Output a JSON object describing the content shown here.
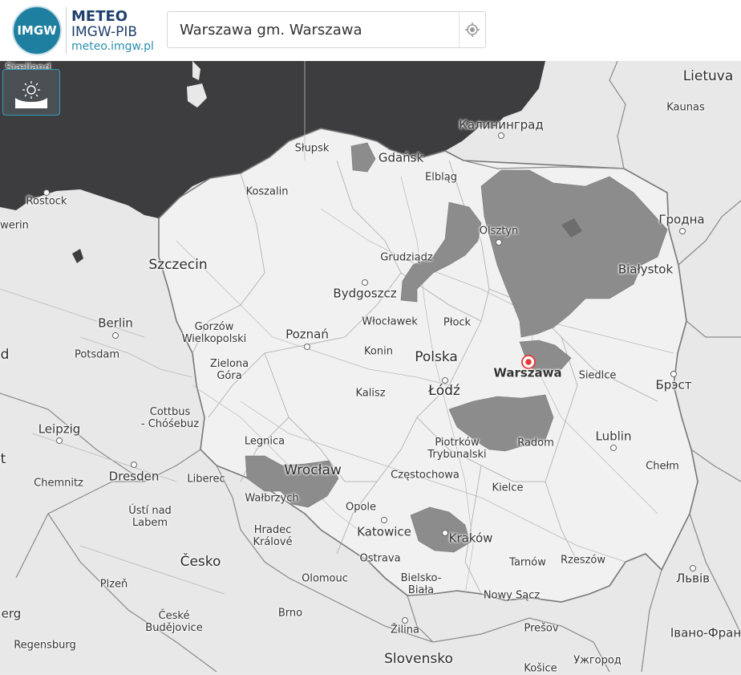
{
  "header": {
    "logo_text": "IMGW",
    "brand_line1": "METEO",
    "brand_line2": "IMGW-PIB",
    "brand_line3": "meteo.imgw.pl"
  },
  "search": {
    "value": "Warszawa gm. Warszawa",
    "placeholder": "",
    "locate_icon": "crosshair-icon"
  },
  "layer_toggle": {
    "icon": "sun-sea-icon"
  },
  "map": {
    "colors": {
      "sea": "#3d3d3f",
      "land": "#e9e9e9",
      "poland": "#efefef",
      "warning": "#8a8a8a",
      "marker": "#e53935"
    },
    "selected_place": "Warszawa",
    "labels": {
      "sjaelland": "Sjælland",
      "lietuva": "Lietuva",
      "kaunas": "Kaunas",
      "kaliningrad": "Калининград",
      "slupsk": "Słupsk",
      "gdansk": "Gdańsk",
      "elblag": "Elbląg",
      "rostock": "Rostock",
      "koszalin": "Koszalin",
      "hrodna": "Гродна",
      "olsztyn": "Olsztyn",
      "werin": "werin",
      "szczecin": "Szczecin",
      "grudziadz": "Grudziądz",
      "bialystok": "Białystok",
      "bydgoszcz": "Bydgoszcz",
      "berlin": "Berlin",
      "gorzow": "Gorzów\nWielkopolski",
      "poznan": "Poznań",
      "wloclawek": "Włocławek",
      "plock": "Płock",
      "potsdam": "Potsdam",
      "d_edge": "d",
      "konin": "Konin",
      "polska": "Polska",
      "warszawa": "Warszawa",
      "siedlce": "Siedlce",
      "zielona": "Zielona\nGóra",
      "brest": "Брэст",
      "kalisz": "Kalisz",
      "lodz": "Łódź",
      "cottbus": "Cottbus\n- Chóśebuz",
      "leipzig": "Leipzig",
      "radom": "Radom",
      "lublin": "Lublin",
      "legnica": "Legnica",
      "piotrkow": "Piotrków\nTrybunalski",
      "t_edge": "t",
      "chelm": "Chełm",
      "wroclaw": "Wrocław",
      "dresden": "Dresden",
      "chemnitz": "Chemnitz",
      "liberec": "Liberec",
      "czestochowa": "Częstochowa",
      "kielce": "Kielce",
      "walbrzych": "Wałbrzych",
      "opole": "Opole",
      "usti": "Ústí nad\nLabem",
      "hradec": "Hradec\nKrálové",
      "katowice": "Katowice",
      "krakow": "Kraków",
      "cesko": "Česko",
      "ostrava": "Ostrava",
      "tarnow": "Tarnów",
      "rzeszow": "Rzeszów",
      "lviv": "Львів",
      "plzen": "Plzeň",
      "olomouc": "Olomouc",
      "bielsko": "Bielsko-\nBiała",
      "nowy_sacz": "Nowy Sącz",
      "erg_edge": "erg",
      "brno": "Brno",
      "ceske": "České\nBudějovice",
      "zilina": "Žilina",
      "presov": "Prešov",
      "ivano": "Івано-Фран",
      "regensburg": "Regensburg",
      "slovensko": "Slovensko",
      "kosice": "Košice",
      "uzhhorod": "Ужгород"
    }
  }
}
